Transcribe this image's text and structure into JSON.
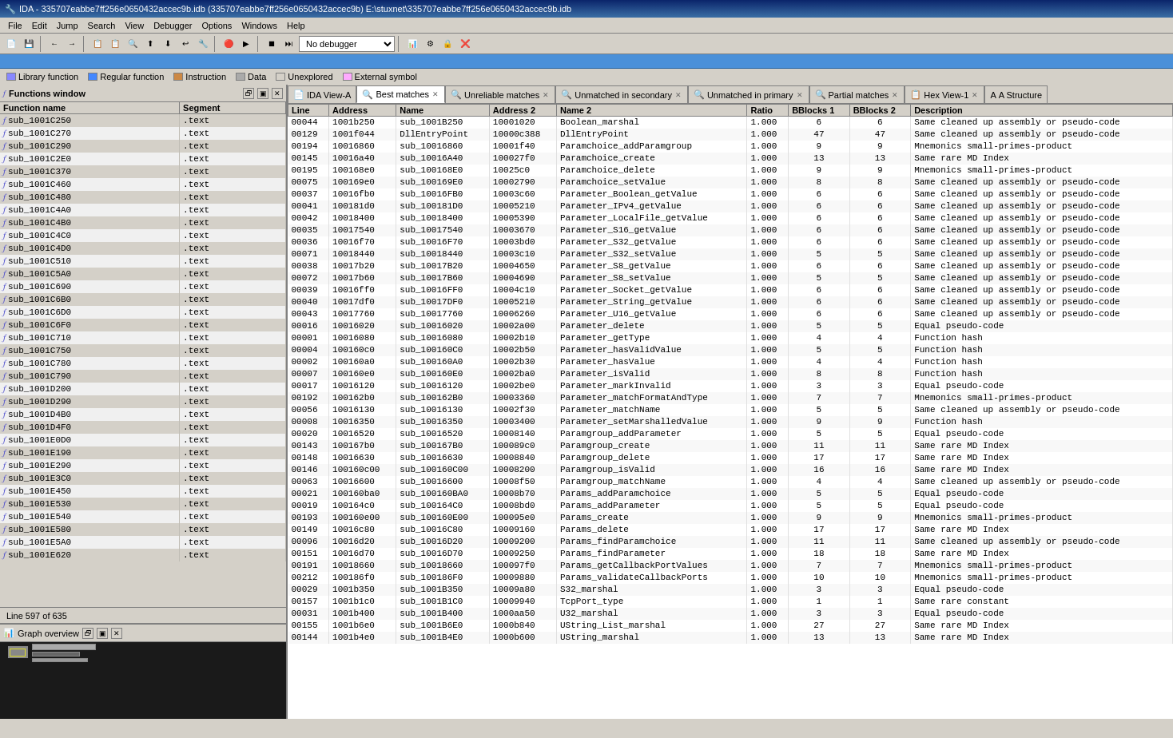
{
  "titleBar": {
    "text": "IDA - 335707eabbe7ff256e0650432accec9b.idb (335707eabbe7ff256e0650432accec9b) E:\\stuxnet\\335707eabbe7ff256e0650432accec9b.idb"
  },
  "menuBar": {
    "items": [
      "File",
      "Edit",
      "Jump",
      "Search",
      "View",
      "Debugger",
      "Options",
      "Windows",
      "Help"
    ]
  },
  "legend": {
    "items": [
      {
        "label": "Library function",
        "color": "#8888ff"
      },
      {
        "label": "Regular function",
        "color": "#4488ff"
      },
      {
        "label": "Instruction",
        "color": "#cc8844"
      },
      {
        "label": "Data",
        "color": "#aaaaaa"
      },
      {
        "label": "Unexplored",
        "color": "#d4d0c8"
      },
      {
        "label": "External symbol",
        "color": "#ffaaff"
      }
    ]
  },
  "functionsWindow": {
    "title": "Functions window",
    "columns": [
      "Function name",
      "Segment"
    ],
    "functions": [
      {
        "name": "sub_1001C250",
        "segment": ".text"
      },
      {
        "name": "sub_1001C270",
        "segment": ".text"
      },
      {
        "name": "sub_1001C290",
        "segment": ".text"
      },
      {
        "name": "sub_1001C2E0",
        "segment": ".text"
      },
      {
        "name": "sub_1001C370",
        "segment": ".text"
      },
      {
        "name": "sub_1001C460",
        "segment": ".text"
      },
      {
        "name": "sub_1001C480",
        "segment": ".text"
      },
      {
        "name": "sub_1001C4A0",
        "segment": ".text"
      },
      {
        "name": "sub_1001C4B0",
        "segment": ".text"
      },
      {
        "name": "sub_1001C4C0",
        "segment": ".text"
      },
      {
        "name": "sub_1001C4D0",
        "segment": ".text"
      },
      {
        "name": "sub_1001C510",
        "segment": ".text"
      },
      {
        "name": "sub_1001C5A0",
        "segment": ".text"
      },
      {
        "name": "sub_1001C690",
        "segment": ".text"
      },
      {
        "name": "sub_1001C6B0",
        "segment": ".text"
      },
      {
        "name": "sub_1001C6D0",
        "segment": ".text"
      },
      {
        "name": "sub_1001C6F0",
        "segment": ".text"
      },
      {
        "name": "sub_1001C710",
        "segment": ".text"
      },
      {
        "name": "sub_1001C750",
        "segment": ".text"
      },
      {
        "name": "sub_1001C780",
        "segment": ".text"
      },
      {
        "name": "sub_1001C790",
        "segment": ".text"
      },
      {
        "name": "sub_1001D200",
        "segment": ".text"
      },
      {
        "name": "sub_1001D290",
        "segment": ".text"
      },
      {
        "name": "sub_1001D4B0",
        "segment": ".text"
      },
      {
        "name": "sub_1001D4F0",
        "segment": ".text"
      },
      {
        "name": "sub_1001E0D0",
        "segment": ".text"
      },
      {
        "name": "sub_1001E190",
        "segment": ".text"
      },
      {
        "name": "sub_1001E290",
        "segment": ".text"
      },
      {
        "name": "sub_1001E3C0",
        "segment": ".text"
      },
      {
        "name": "sub_1001E450",
        "segment": ".text"
      },
      {
        "name": "sub_1001E530",
        "segment": ".text"
      },
      {
        "name": "sub_1001E540",
        "segment": ".text"
      },
      {
        "name": "sub_1001E580",
        "segment": ".text"
      },
      {
        "name": "sub_1001E5A0",
        "segment": ".text"
      },
      {
        "name": "sub_1001E620",
        "segment": ".text"
      }
    ]
  },
  "statusBar": {
    "text": "Line 597 of 635"
  },
  "graphOverview": {
    "title": "Graph overview"
  },
  "tabs": [
    {
      "label": "IDA View-A",
      "icon": "📄",
      "active": false,
      "closeable": false
    },
    {
      "label": "Best matches",
      "icon": "🔍",
      "active": true,
      "closeable": true
    },
    {
      "label": "Unreliable matches",
      "icon": "🔍",
      "active": false,
      "closeable": true
    },
    {
      "label": "Unmatched in secondary",
      "icon": "🔍",
      "active": false,
      "closeable": true
    },
    {
      "label": "Unmatched in primary",
      "icon": "🔍",
      "active": false,
      "closeable": true
    },
    {
      "label": "Partial matches",
      "icon": "🔍",
      "active": false,
      "closeable": true
    },
    {
      "label": "Hex View-1",
      "icon": "📋",
      "active": false,
      "closeable": true
    },
    {
      "label": "A Structure",
      "icon": "A",
      "active": false,
      "closeable": false
    }
  ],
  "matchesTable": {
    "columns": [
      "Line",
      "Address",
      "Name",
      "Address 2",
      "Name 2",
      "Ratio",
      "BBlocks 1",
      "BBlocks 2",
      "Description"
    ],
    "rows": [
      {
        "line": "00044",
        "address": "1001b250",
        "name": "sub_1001B250",
        "address2": "10001020",
        "name2": "Boolean_marshal",
        "ratio": "1.000",
        "bb1": "6",
        "bb2": "6",
        "desc": "Same cleaned up assembly or pseudo-code"
      },
      {
        "line": "00129",
        "address": "1001f044",
        "name": "DllEntryPoint",
        "address2": "10000c388",
        "name2": "DllEntryPoint",
        "ratio": "1.000",
        "bb1": "47",
        "bb2": "47",
        "desc": "Same cleaned up assembly or pseudo-code"
      },
      {
        "line": "00194",
        "address": "10016860",
        "name": "sub_10016860",
        "address2": "10001f40",
        "name2": "Paramchoice_addParamgroup",
        "ratio": "1.000",
        "bb1": "9",
        "bb2": "9",
        "desc": "Mnemonics small-primes-product"
      },
      {
        "line": "00145",
        "address": "10016a40",
        "name": "sub_10016A40",
        "address2": "100027f0",
        "name2": "Paramchoice_create",
        "ratio": "1.000",
        "bb1": "13",
        "bb2": "13",
        "desc": "Same rare MD Index"
      },
      {
        "line": "00195",
        "address": "100168e0",
        "name": "sub_100168E0",
        "address2": "10025c0",
        "name2": "Paramchoice_delete",
        "ratio": "1.000",
        "bb1": "9",
        "bb2": "9",
        "desc": "Mnemonics small-primes-product"
      },
      {
        "line": "00075",
        "address": "100169e0",
        "name": "sub_100169E0",
        "address2": "10002790",
        "name2": "Paramchoice_setValue",
        "ratio": "1.000",
        "bb1": "8",
        "bb2": "8",
        "desc": "Same cleaned up assembly or pseudo-code"
      },
      {
        "line": "00037",
        "address": "10016fb0",
        "name": "sub_10016FB0",
        "address2": "10003c60",
        "name2": "Parameter_Boolean_getValue",
        "ratio": "1.000",
        "bb1": "6",
        "bb2": "6",
        "desc": "Same cleaned up assembly or pseudo-code"
      },
      {
        "line": "00041",
        "address": "100181d0",
        "name": "sub_100181D0",
        "address2": "10005210",
        "name2": "Parameter_IPv4_getValue",
        "ratio": "1.000",
        "bb1": "6",
        "bb2": "6",
        "desc": "Same cleaned up assembly or pseudo-code"
      },
      {
        "line": "00042",
        "address": "10018400",
        "name": "sub_10018400",
        "address2": "10005390",
        "name2": "Parameter_LocalFile_getValue",
        "ratio": "1.000",
        "bb1": "6",
        "bb2": "6",
        "desc": "Same cleaned up assembly or pseudo-code"
      },
      {
        "line": "00035",
        "address": "10017540",
        "name": "sub_10017540",
        "address2": "10003670",
        "name2": "Parameter_S16_getValue",
        "ratio": "1.000",
        "bb1": "6",
        "bb2": "6",
        "desc": "Same cleaned up assembly or pseudo-code"
      },
      {
        "line": "00036",
        "address": "10016f70",
        "name": "sub_10016F70",
        "address2": "10003bd0",
        "name2": "Parameter_S32_getValue",
        "ratio": "1.000",
        "bb1": "6",
        "bb2": "6",
        "desc": "Same cleaned up assembly or pseudo-code"
      },
      {
        "line": "00071",
        "address": "10018440",
        "name": "sub_10018440",
        "address2": "10003c10",
        "name2": "Parameter_S32_setValue",
        "ratio": "1.000",
        "bb1": "5",
        "bb2": "5",
        "desc": "Same cleaned up assembly or pseudo-code"
      },
      {
        "line": "00038",
        "address": "10017b20",
        "name": "sub_10017B20",
        "address2": "10004650",
        "name2": "Parameter_S8_getValue",
        "ratio": "1.000",
        "bb1": "6",
        "bb2": "6",
        "desc": "Same cleaned up assembly or pseudo-code"
      },
      {
        "line": "00072",
        "address": "10017b60",
        "name": "sub_10017B60",
        "address2": "10004690",
        "name2": "Parameter_S8_setValue",
        "ratio": "1.000",
        "bb1": "5",
        "bb2": "5",
        "desc": "Same cleaned up assembly or pseudo-code"
      },
      {
        "line": "00039",
        "address": "10016ff0",
        "name": "sub_10016FF0",
        "address2": "10004c10",
        "name2": "Parameter_Socket_getValue",
        "ratio": "1.000",
        "bb1": "6",
        "bb2": "6",
        "desc": "Same cleaned up assembly or pseudo-code"
      },
      {
        "line": "00040",
        "address": "10017df0",
        "name": "sub_10017DF0",
        "address2": "10005210",
        "name2": "Parameter_String_getValue",
        "ratio": "1.000",
        "bb1": "6",
        "bb2": "6",
        "desc": "Same cleaned up assembly or pseudo-code"
      },
      {
        "line": "00043",
        "address": "10017760",
        "name": "sub_10017760",
        "address2": "10006260",
        "name2": "Parameter_U16_getValue",
        "ratio": "1.000",
        "bb1": "6",
        "bb2": "6",
        "desc": "Same cleaned up assembly or pseudo-code"
      },
      {
        "line": "00016",
        "address": "10016020",
        "name": "sub_10016020",
        "address2": "10002a00",
        "name2": "Parameter_delete",
        "ratio": "1.000",
        "bb1": "5",
        "bb2": "5",
        "desc": "Equal pseudo-code"
      },
      {
        "line": "00001",
        "address": "10016080",
        "name": "sub_10016080",
        "address2": "10002b10",
        "name2": "Parameter_getType",
        "ratio": "1.000",
        "bb1": "4",
        "bb2": "4",
        "desc": "Function hash"
      },
      {
        "line": "00004",
        "address": "100160c0",
        "name": "sub_100160C0",
        "address2": "10002b50",
        "name2": "Parameter_hasValidValue",
        "ratio": "1.000",
        "bb1": "5",
        "bb2": "5",
        "desc": "Function hash"
      },
      {
        "line": "00002",
        "address": "100160a0",
        "name": "sub_100160A0",
        "address2": "10002b30",
        "name2": "Parameter_hasValue",
        "ratio": "1.000",
        "bb1": "4",
        "bb2": "4",
        "desc": "Function hash"
      },
      {
        "line": "00007",
        "address": "100160e0",
        "name": "sub_100160E0",
        "address2": "10002ba0",
        "name2": "Parameter_isValid",
        "ratio": "1.000",
        "bb1": "8",
        "bb2": "8",
        "desc": "Function hash"
      },
      {
        "line": "00017",
        "address": "10016120",
        "name": "sub_10016120",
        "address2": "10002be0",
        "name2": "Parameter_markInvalid",
        "ratio": "1.000",
        "bb1": "3",
        "bb2": "3",
        "desc": "Equal pseudo-code"
      },
      {
        "line": "00192",
        "address": "100162b0",
        "name": "sub_100162B0",
        "address2": "10003360",
        "name2": "Parameter_matchFormatAndType",
        "ratio": "1.000",
        "bb1": "7",
        "bb2": "7",
        "desc": "Mnemonics small-primes-product"
      },
      {
        "line": "00056",
        "address": "10016130",
        "name": "sub_10016130",
        "address2": "10002f30",
        "name2": "Parameter_matchName",
        "ratio": "1.000",
        "bb1": "5",
        "bb2": "5",
        "desc": "Same cleaned up assembly or pseudo-code"
      },
      {
        "line": "00008",
        "address": "10016350",
        "name": "sub_10016350",
        "address2": "10003400",
        "name2": "Parameter_setMarshalledValue",
        "ratio": "1.000",
        "bb1": "9",
        "bb2": "9",
        "desc": "Function hash"
      },
      {
        "line": "00020",
        "address": "10016520",
        "name": "sub_10016520",
        "address2": "10008140",
        "name2": "Paramgroup_addParameter",
        "ratio": "1.000",
        "bb1": "5",
        "bb2": "5",
        "desc": "Equal pseudo-code"
      },
      {
        "line": "00143",
        "address": "100167b0",
        "name": "sub_100167B0",
        "address2": "100089c0",
        "name2": "Paramgroup_create",
        "ratio": "1.000",
        "bb1": "11",
        "bb2": "11",
        "desc": "Same rare MD Index"
      },
      {
        "line": "00148",
        "address": "10016630",
        "name": "sub_10016630",
        "address2": "10008840",
        "name2": "Paramgroup_delete",
        "ratio": "1.000",
        "bb1": "17",
        "bb2": "17",
        "desc": "Same rare MD Index"
      },
      {
        "line": "00146",
        "address": "100160c00",
        "name": "sub_100160C00",
        "address2": "10008200",
        "name2": "Paramgroup_isValid",
        "ratio": "1.000",
        "bb1": "16",
        "bb2": "16",
        "desc": "Same rare MD Index"
      },
      {
        "line": "00063",
        "address": "10016600",
        "name": "sub_10016600",
        "address2": "10008f50",
        "name2": "Paramgroup_matchName",
        "ratio": "1.000",
        "bb1": "4",
        "bb2": "4",
        "desc": "Same cleaned up assembly or pseudo-code"
      },
      {
        "line": "00021",
        "address": "100160ba0",
        "name": "sub_100160BA0",
        "address2": "10008b70",
        "name2": "Params_addParamchoice",
        "ratio": "1.000",
        "bb1": "5",
        "bb2": "5",
        "desc": "Equal pseudo-code"
      },
      {
        "line": "00019",
        "address": "100164c0",
        "name": "sub_100164C0",
        "address2": "10008bd0",
        "name2": "Params_addParameter",
        "ratio": "1.000",
        "bb1": "5",
        "bb2": "5",
        "desc": "Equal pseudo-code"
      },
      {
        "line": "00193",
        "address": "100160e00",
        "name": "sub_100160E00",
        "address2": "100095e0",
        "name2": "Params_create",
        "ratio": "1.000",
        "bb1": "9",
        "bb2": "9",
        "desc": "Mnemonics small-primes-product"
      },
      {
        "line": "00149",
        "address": "10016c80",
        "name": "sub_10016C80",
        "address2": "10009160",
        "name2": "Params_delete",
        "ratio": "1.000",
        "bb1": "17",
        "bb2": "17",
        "desc": "Same rare MD Index"
      },
      {
        "line": "00096",
        "address": "10016d20",
        "name": "sub_10016D20",
        "address2": "10009200",
        "name2": "Params_findParamchoice",
        "ratio": "1.000",
        "bb1": "11",
        "bb2": "11",
        "desc": "Same cleaned up assembly or pseudo-code"
      },
      {
        "line": "00151",
        "address": "10016d70",
        "name": "sub_10016D70",
        "address2": "10009250",
        "name2": "Params_findParameter",
        "ratio": "1.000",
        "bb1": "18",
        "bb2": "18",
        "desc": "Same rare MD Index"
      },
      {
        "line": "00191",
        "address": "10018660",
        "name": "sub_10018660",
        "address2": "100097f0",
        "name2": "Params_getCallbackPortValues",
        "ratio": "1.000",
        "bb1": "7",
        "bb2": "7",
        "desc": "Mnemonics small-primes-product"
      },
      {
        "line": "00212",
        "address": "100186f0",
        "name": "sub_100186F0",
        "address2": "10009880",
        "name2": "Params_validateCallbackPorts",
        "ratio": "1.000",
        "bb1": "10",
        "bb2": "10",
        "desc": "Mnemonics small-primes-product"
      },
      {
        "line": "00029",
        "address": "1001b350",
        "name": "sub_1001B350",
        "address2": "10009a80",
        "name2": "S32_marshal",
        "ratio": "1.000",
        "bb1": "3",
        "bb2": "3",
        "desc": "Equal pseudo-code"
      },
      {
        "line": "00157",
        "address": "1001b1c0",
        "name": "sub_1001B1C0",
        "address2": "10009940",
        "name2": "TcpPort_type",
        "ratio": "1.000",
        "bb1": "1",
        "bb2": "1",
        "desc": "Same rare constant"
      },
      {
        "line": "00031",
        "address": "1001b400",
        "name": "sub_1001B400",
        "address2": "1000aa50",
        "name2": "U32_marshal",
        "ratio": "1.000",
        "bb1": "3",
        "bb2": "3",
        "desc": "Equal pseudo-code"
      },
      {
        "line": "00155",
        "address": "1001b6e0",
        "name": "sub_1001B6E0",
        "address2": "1000b840",
        "name2": "UString_List_marshal",
        "ratio": "1.000",
        "bb1": "27",
        "bb2": "27",
        "desc": "Same rare MD Index"
      },
      {
        "line": "00144",
        "address": "1001b4e0",
        "name": "sub_1001B4E0",
        "address2": "1000b600",
        "name2": "UString_marshal",
        "ratio": "1.000",
        "bb1": "13",
        "bb2": "13",
        "desc": "Same rare MD Index"
      }
    ]
  }
}
